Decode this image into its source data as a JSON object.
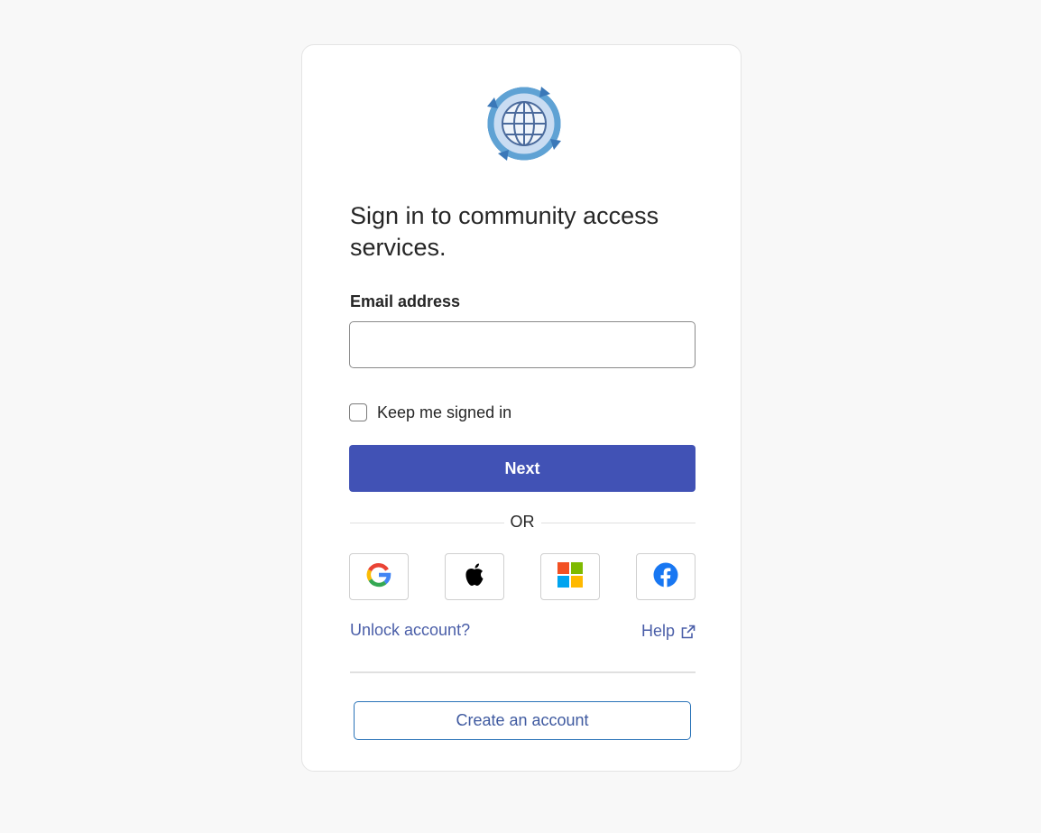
{
  "signin": {
    "title": "Sign in to community access services.",
    "email_label": "Email address",
    "email_value": "",
    "email_placeholder": "",
    "keep_signed_in_label": "Keep me signed in",
    "keep_signed_in_checked": false,
    "next_label": "Next",
    "or_label": "OR",
    "social_providers": [
      {
        "name": "Google",
        "icon": "google-icon"
      },
      {
        "name": "Apple",
        "icon": "apple-icon"
      },
      {
        "name": "Microsoft",
        "icon": "microsoft-icon"
      },
      {
        "name": "Facebook",
        "icon": "facebook-icon"
      }
    ],
    "unlock_label": "Unlock account?",
    "help_label": "Help",
    "create_account_label": "Create an account"
  },
  "colors": {
    "page_background": "#f8f8f8",
    "primary_button": "#4152b5",
    "link": "#4a5ea8",
    "create_border": "#2a73b8"
  },
  "logo": {
    "icon": "globe-arrows-logo"
  }
}
